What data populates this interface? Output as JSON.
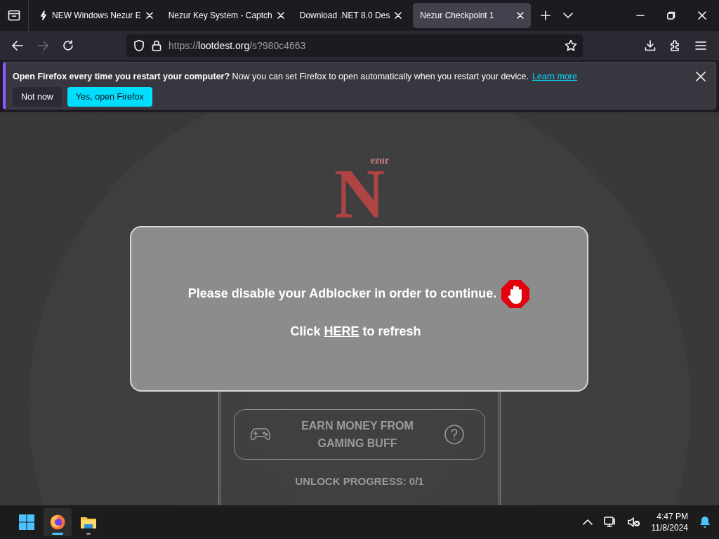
{
  "browser": {
    "tabs": [
      {
        "label": "NEW Windows Nezur E",
        "kind": "icon",
        "selected": false
      },
      {
        "label": "Nezur Key System - Captch",
        "kind": "plain",
        "selected": false
      },
      {
        "label": "Download .NET 8.0 Des",
        "kind": "plain",
        "selected": false
      },
      {
        "label": "Nezur Checkpoint 1",
        "kind": "plain",
        "selected": true
      }
    ],
    "address": {
      "scheme": "https://",
      "host": "lootdest.org",
      "path": "/s?980c4663"
    },
    "forward_disabled": true
  },
  "notification": {
    "message": "**Open Firefox every time you restart your computer?** Now you can set Firefox to open automatically when you restart your device.",
    "link": "Learn more",
    "buttons": [
      {
        "label": "Not now",
        "kind": "secondary"
      },
      {
        "label": "Yes, open Firefox",
        "kind": "primary"
      }
    ]
  },
  "page": {
    "logo": {
      "letter": "N",
      "suffix": "ezur"
    },
    "task": {
      "label": "EARN MONEY FROM GAMING BUFF"
    },
    "progress": "UNLOCK PROGRESS: 0/1",
    "modal": {
      "message": "Please disable your Adblocker in order to continue.",
      "refresh_before": "Click",
      "refresh_link": "HERE",
      "refresh_after": "to refresh"
    }
  },
  "taskbar": {
    "apps": [
      {
        "kind": "firefox",
        "selected": true
      },
      {
        "kind": "folder",
        "selected": false
      }
    ],
    "time": "4:47 PM",
    "date": "11/8/2024"
  }
}
